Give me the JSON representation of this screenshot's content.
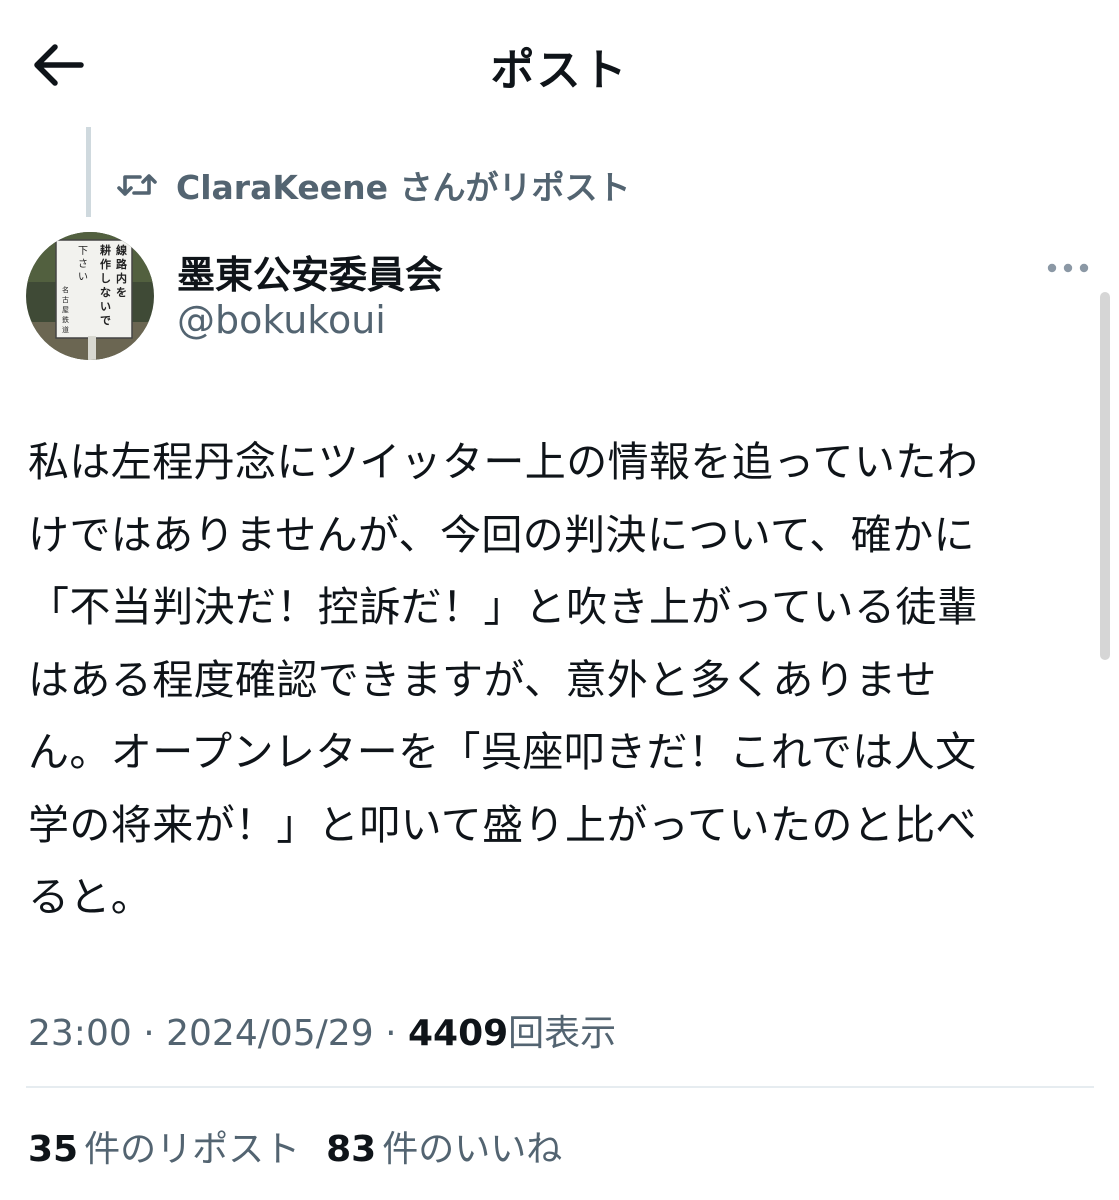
{
  "header": {
    "title": "ポスト"
  },
  "repost": {
    "text": "ClaraKeene さんがリポスト"
  },
  "author": {
    "name": "墨東公安委員会",
    "handle": "@bokukoui",
    "avatar_sign_text": "線路内を耕作しないで下さい 名古屋鉄道"
  },
  "post": {
    "lines": [
      "私は左程丹念にツイッター上の情報を追っていたわ",
      "けではありませんが、今回の判決について、確かに",
      "「不当判決だ！控訴だ！」と吹き上がっている徒輩",
      "はある程度確認できますが、意外と多くありませ",
      "ん。オープンレターを「呉座叩きだ！これでは人文",
      "学の将来が！」と叩いて盛り上がっていたのと比べ",
      "ると。"
    ]
  },
  "meta": {
    "time": "23:00",
    "separator": "·",
    "date": "2024/05/29",
    "views_count": "4409",
    "views_label": "回表示"
  },
  "stats": {
    "reposts_count": "35",
    "reposts_label": "件のリポスト",
    "likes_count": "83",
    "likes_label": "件のいいね"
  },
  "colors": {
    "text_primary": "#0f1419",
    "text_secondary": "#536471",
    "divider": "#e6ecf0"
  },
  "icons": {
    "back": "arrow-left-icon",
    "repost": "repost-icon",
    "more": "more-horizontal-icon"
  }
}
